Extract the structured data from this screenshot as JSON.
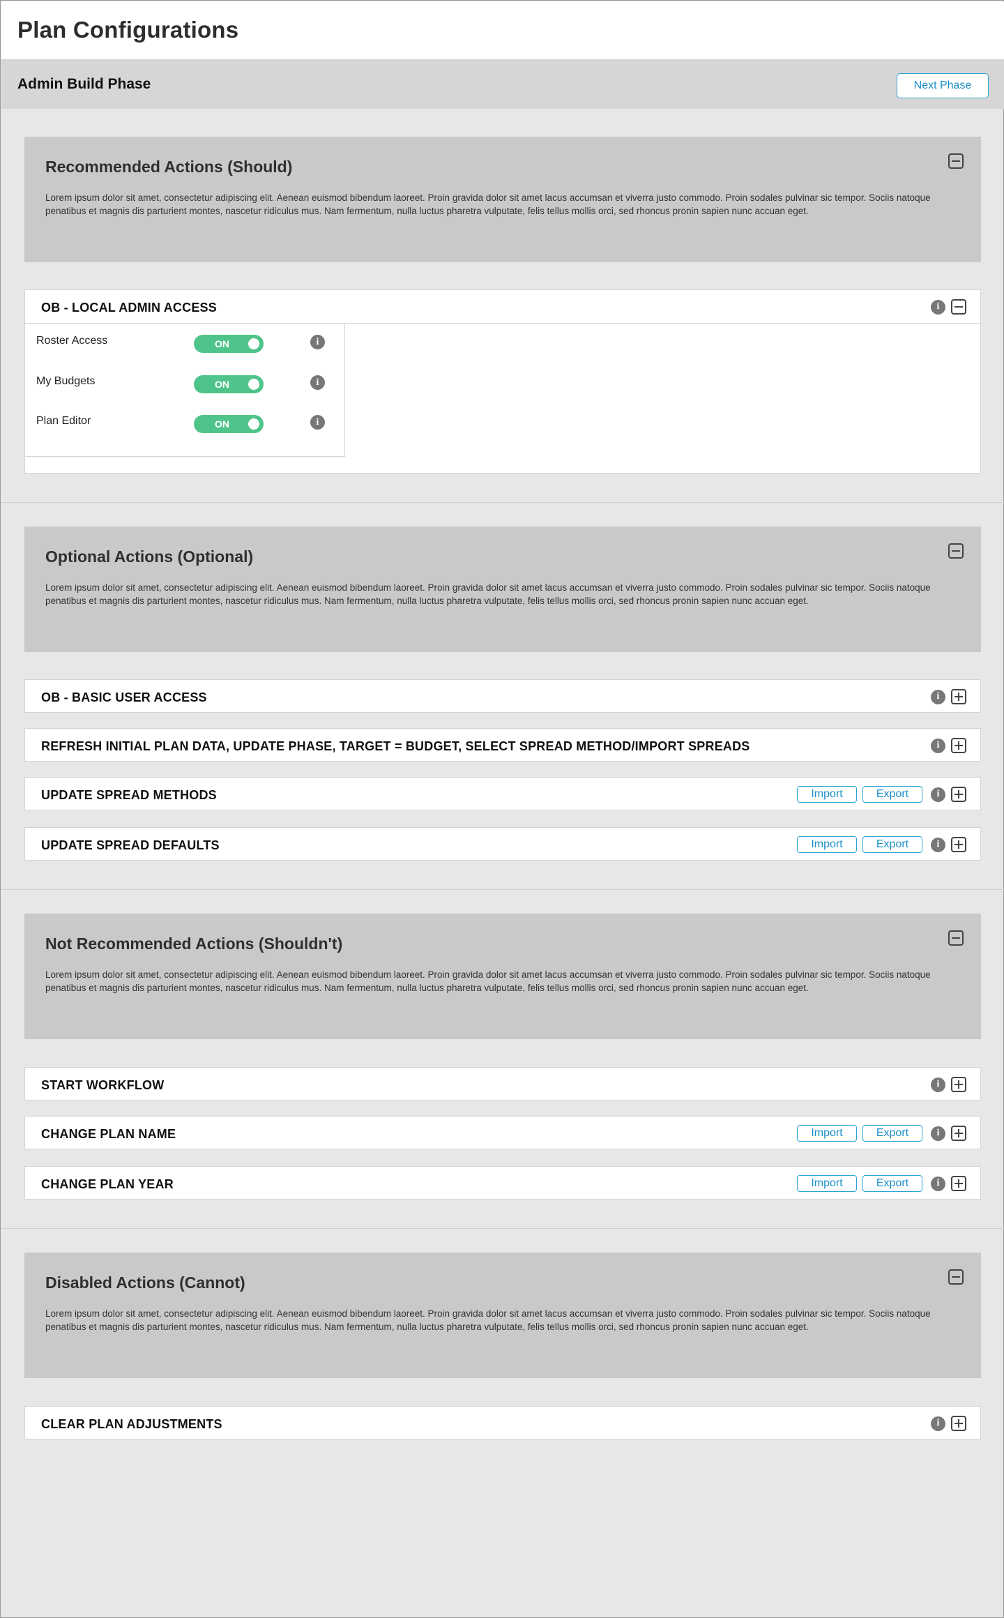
{
  "page": {
    "title": "Plan Configurations"
  },
  "phase_bar": {
    "title": "Admin Build Phase",
    "next_label": "Next Phase"
  },
  "common": {
    "info_glyph": "i",
    "import_label": "Import",
    "export_label": "Export",
    "accent_color": "#2aa4d6",
    "toggle_color": "#4fc48a"
  },
  "categories": [
    {
      "title": "Recommended Actions (Should)",
      "description": "Lorem ipsum dolor sit amet, consectetur adipiscing elit. Aenean euismod bibendum laoreet. Proin gravida dolor sit amet lacus accumsan et viverra justo commodo. Proin sodales pulvinar sic tempor. Sociis natoque penatibus et magnis dis parturient montes, nascetur ridiculus mus. Nam fermentum, nulla luctus pharetra vulputate, felis tellus mollis orci, sed rhoncus pronin sapien nunc accuan eget.",
      "actions": [
        {
          "title": "OB - LOCAL ADMIN ACCESS",
          "expanded": true,
          "settings": [
            {
              "label": "Roster Access",
              "state": "ON"
            },
            {
              "label": "My Budgets",
              "state": "ON"
            },
            {
              "label": "Plan Editor",
              "state": "ON"
            }
          ]
        }
      ]
    },
    {
      "title": "Optional Actions (Optional)",
      "description": "Lorem ipsum dolor sit amet, consectetur adipiscing elit. Aenean euismod bibendum laoreet. Proin gravida dolor sit amet lacus accumsan et viverra justo commodo. Proin sodales pulvinar sic tempor. Sociis natoque penatibus et magnis dis parturient montes, nascetur ridiculus mus. Nam fermentum, nulla luctus pharetra vulputate, felis tellus mollis orci, sed rhoncus pronin sapien nunc accuan eget.",
      "actions": [
        {
          "title": "OB - BASIC USER ACCESS",
          "import_export": false
        },
        {
          "title": "REFRESH INITIAL PLAN DATA, UPDATE PHASE, TARGET = BUDGET, SELECT SPREAD METHOD/IMPORT SPREADS",
          "import_export": false
        },
        {
          "title": "UPDATE SPREAD METHODS",
          "import_export": true
        },
        {
          "title": "UPDATE SPREAD DEFAULTS",
          "import_export": true
        }
      ]
    },
    {
      "title": "Not Recommended Actions (Shouldn't)",
      "description": "Lorem ipsum dolor sit amet, consectetur adipiscing elit. Aenean euismod bibendum laoreet. Proin gravida dolor sit amet lacus accumsan et viverra justo commodo. Proin sodales pulvinar sic tempor. Sociis natoque penatibus et magnis dis parturient montes, nascetur ridiculus mus. Nam fermentum, nulla luctus pharetra vulputate, felis tellus mollis orci, sed rhoncus pronin sapien nunc accuan eget.",
      "actions": [
        {
          "title": "START WORKFLOW",
          "import_export": false
        },
        {
          "title": "CHANGE PLAN NAME",
          "import_export": true
        },
        {
          "title": "CHANGE PLAN YEAR",
          "import_export": true
        }
      ]
    },
    {
      "title": "Disabled Actions (Cannot)",
      "description": "Lorem ipsum dolor sit amet, consectetur adipiscing elit. Aenean euismod bibendum laoreet. Proin gravida dolor sit amet lacus accumsan et viverra justo commodo. Proin sodales pulvinar sic tempor. Sociis natoque penatibus et magnis dis parturient montes, nascetur ridiculus mus. Nam fermentum, nulla luctus pharetra vulputate, felis tellus mollis orci, sed rhoncus pronin sapien nunc accuan eget.",
      "actions": [
        {
          "title": "CLEAR PLAN ADJUSTMENTS",
          "import_export": false
        }
      ]
    }
  ]
}
